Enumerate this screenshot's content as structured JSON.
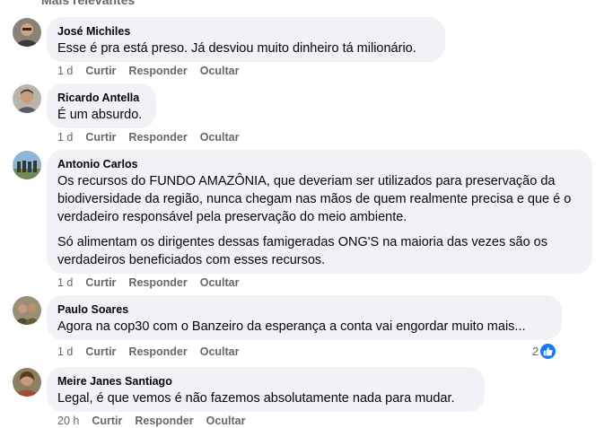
{
  "header_cut": "Mais relevantes",
  "actions": {
    "like": "Curtir",
    "reply": "Responder",
    "hide": "Ocultar"
  },
  "comments": [
    {
      "author": "José Michiles",
      "paragraphs": [
        "Esse é pra está preso. Já desviou muito dinheiro tá milionário."
      ],
      "time": "1 d"
    },
    {
      "author": "Ricardo Antella",
      "paragraphs": [
        "É um absurdo."
      ],
      "time": "1 d"
    },
    {
      "author": "Antonio Carlos",
      "paragraphs": [
        "Os recursos do FUNDO AMAZÔNIA, que deveriam ser utilizados para preservação da biodiversidade da região, nunca chegam nas mãos de quem realmente precisa e que é o verdadeiro responsável pela preservação do meio ambiente.",
        "Só alimentam os dirigentes dessas famigeradas ONG'S na maioria das vezes são os verdadeiros beneficiados com esses recursos."
      ],
      "time": "1 d"
    },
    {
      "author": "Paulo Soares",
      "paragraphs": [
        "Agora na cop30 com o Banzeiro da esperança a conta vai engordar muito mais..."
      ],
      "time": "1 d",
      "reaction_count": "2",
      "reaction_icon": "like-icon"
    },
    {
      "author": "Meire Janes Santiago",
      "paragraphs": [
        "Legal, é que vemos é não fazemos absolutamente nada para mudar."
      ],
      "time": "20 h"
    }
  ],
  "colors": {
    "bubble": "#f0f2f5",
    "meta": "#65676b",
    "like": "#1877f2"
  }
}
